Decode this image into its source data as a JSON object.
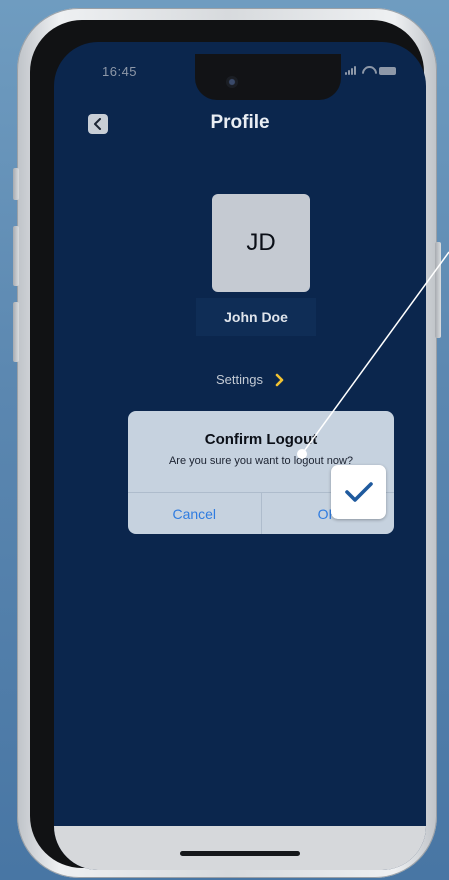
{
  "status_bar": {
    "time": "16:45"
  },
  "header": {
    "title": "Profile"
  },
  "profile": {
    "initials": "JD",
    "name": "John Doe"
  },
  "settings": {
    "label": "Settings"
  },
  "dialog": {
    "title": "Confirm Logout",
    "message": "Are you sure you want to logout now?",
    "cancel_label": "Cancel",
    "ok_label": "OK"
  },
  "colors": {
    "screen_bg": "#0b264d",
    "dialog_bg": "#c6d2df",
    "dialog_button": "#2f7ce0",
    "chevron_accent": "#f1c232",
    "check_color": "#1f5a9e"
  },
  "icons": [
    "camera-icon",
    "signal-icon",
    "wifi-icon",
    "battery-icon",
    "back-chevron-icon",
    "chevron-right-icon",
    "checkmark-icon"
  ]
}
